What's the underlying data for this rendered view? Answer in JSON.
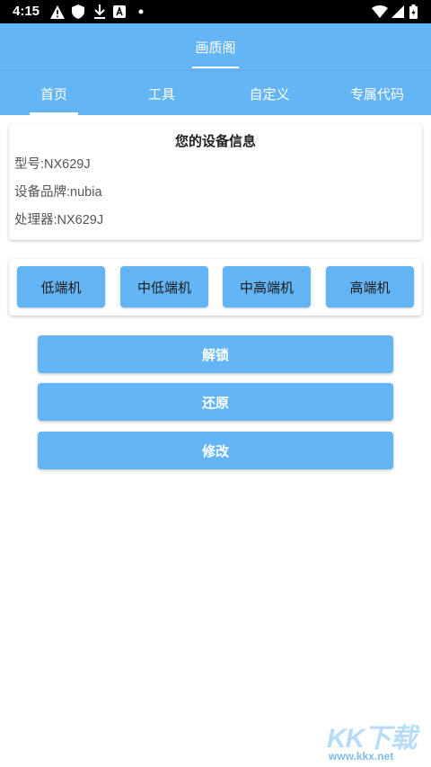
{
  "status_bar": {
    "time": "4:15",
    "left_icons": [
      "warning-icon",
      "shield-icon",
      "download-icon",
      "font-a-icon",
      "dot-icon"
    ],
    "right_icons": [
      "wifi-icon",
      "signal-icon",
      "battery-icon"
    ]
  },
  "app": {
    "title": "画质阁",
    "accent_color": "#64b5f6"
  },
  "tabs": [
    {
      "label": "首页",
      "selected": true
    },
    {
      "label": "工具",
      "selected": false
    },
    {
      "label": "自定义",
      "selected": false
    },
    {
      "label": "专属代码",
      "selected": false
    }
  ],
  "device_info": {
    "heading": "您的设备信息",
    "model": "型号:NX629J",
    "brand": "设备品牌:nubia",
    "processor": "处理器:NX629J"
  },
  "tiers": [
    {
      "label": "低端机"
    },
    {
      "label": "中低端机"
    },
    {
      "label": "中高端机"
    },
    {
      "label": "高端机"
    }
  ],
  "actions": {
    "unlock": "解锁",
    "restore": "还原",
    "modify": "修改"
  },
  "watermark": {
    "logo": "KK下载",
    "url": "www.kkx.net"
  }
}
